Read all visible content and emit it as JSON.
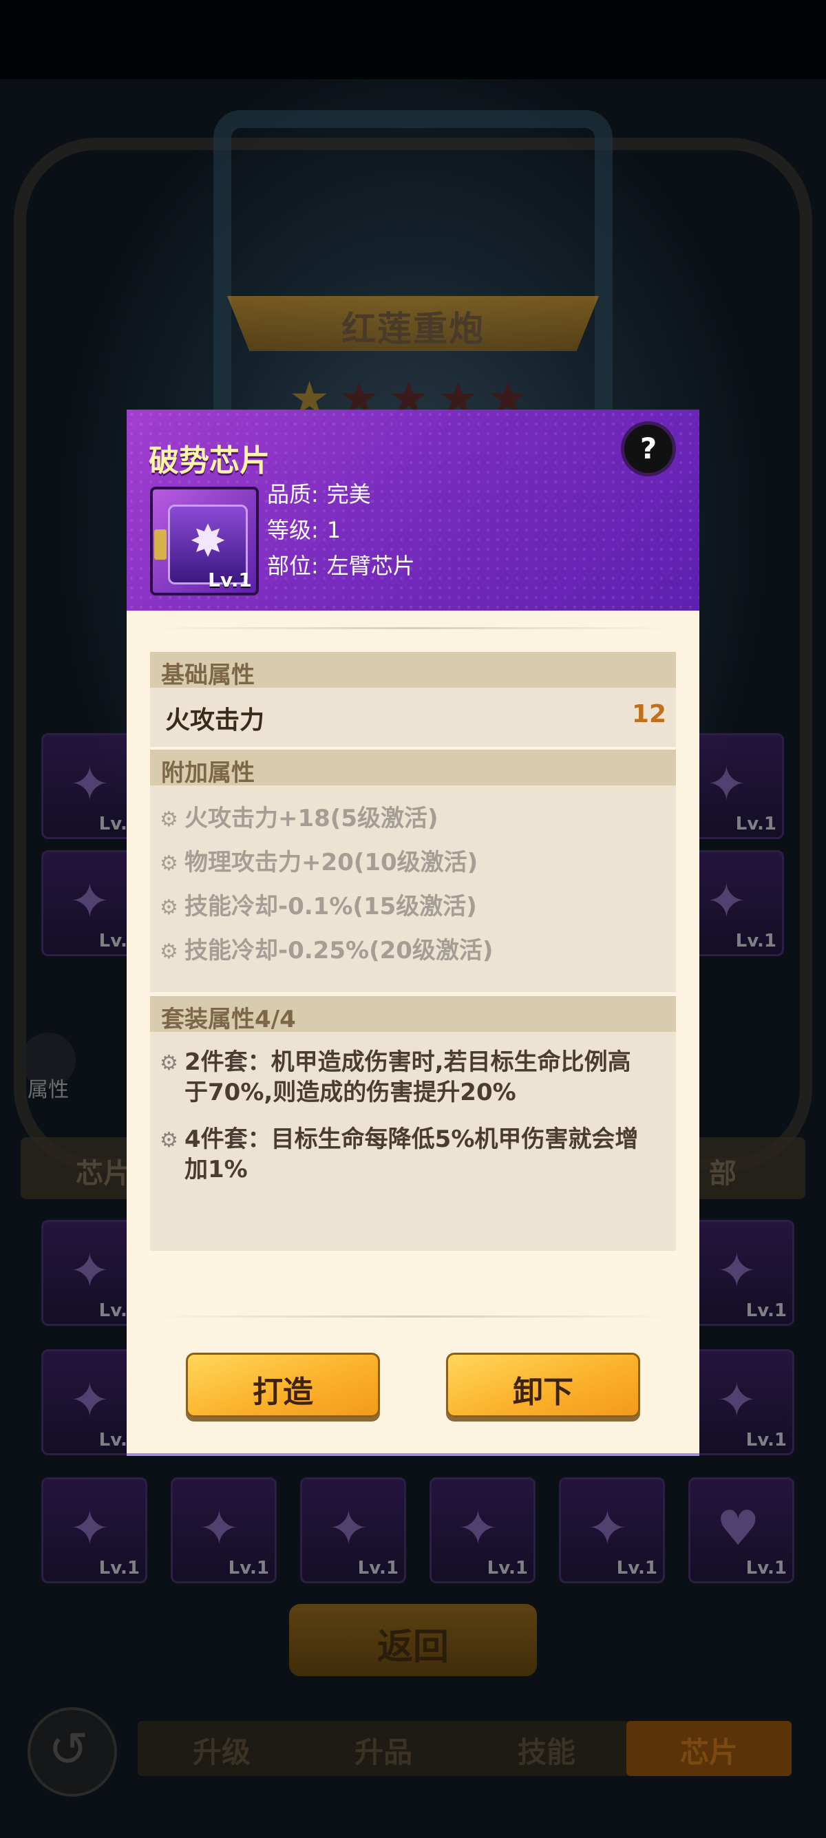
{
  "background": {
    "mech_name": "红莲重炮",
    "stars_total": 5,
    "stars_lit": 1,
    "slot_level": "Lv.1",
    "side_panel_label": "属性",
    "chip_bar_label": "芯片",
    "chip_bar_right": "部",
    "back_button": "返回",
    "tabs": [
      "升级",
      "升品",
      "技能",
      "芯片"
    ],
    "active_tab": "芯片"
  },
  "dialog": {
    "title": "破势芯片",
    "help_icon": "help-icon",
    "chip_level": "Lv.1",
    "info": [
      {
        "key": "品质:",
        "value": "完美"
      },
      {
        "key": "等级:",
        "value": "1"
      },
      {
        "key": "部位:",
        "value": "左臂芯片"
      }
    ],
    "base_section": {
      "heading": "基础属性",
      "stat_name": "火攻击力",
      "stat_value": "12"
    },
    "extra_section": {
      "heading": "附加属性",
      "items": [
        "火攻击力+18(5级激活)",
        "物理攻击力+20(10级激活)",
        "技能冷却-0.1%(15级激活)",
        "技能冷却-0.25%(20级激活)"
      ]
    },
    "set_section": {
      "heading": "套装属性4/4",
      "items": [
        "2件套：机甲造成伤害时,若目标生命比例高于70%,则造成的伤害提升20%",
        "4件套：目标生命每降低5%机甲伤害就会增加1%"
      ]
    },
    "buttons": {
      "forge": "打造",
      "unequip": "卸下"
    },
    "colors": {
      "header": "#7a2cbf",
      "title": "#fff4a8",
      "stat_value": "#c0701a",
      "button": "#fbb22c"
    }
  }
}
